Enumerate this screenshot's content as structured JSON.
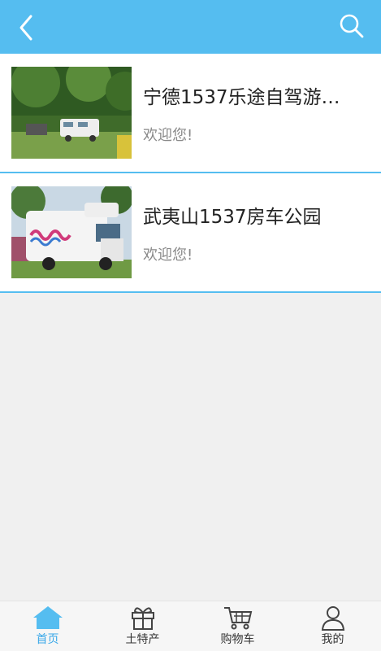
{
  "header": {
    "back_icon": "chevron-left-icon",
    "search_icon": "search-icon",
    "color": "#55bdf0"
  },
  "items": [
    {
      "title": "宁德1537乐途自驾游…",
      "subtitle": "欢迎您!"
    },
    {
      "title": "武夷山1537房车公园",
      "subtitle": "欢迎您!"
    }
  ],
  "tabs": [
    {
      "label": "首页",
      "icon": "home-icon",
      "active": true
    },
    {
      "label": "土特产",
      "icon": "gift-icon",
      "active": false
    },
    {
      "label": "购物车",
      "icon": "cart-icon",
      "active": false
    },
    {
      "label": "我的",
      "icon": "user-icon",
      "active": false
    }
  ],
  "colors": {
    "accent": "#55bdf0",
    "active_tab": "#3aa8e8",
    "background": "#f0f0f0"
  }
}
